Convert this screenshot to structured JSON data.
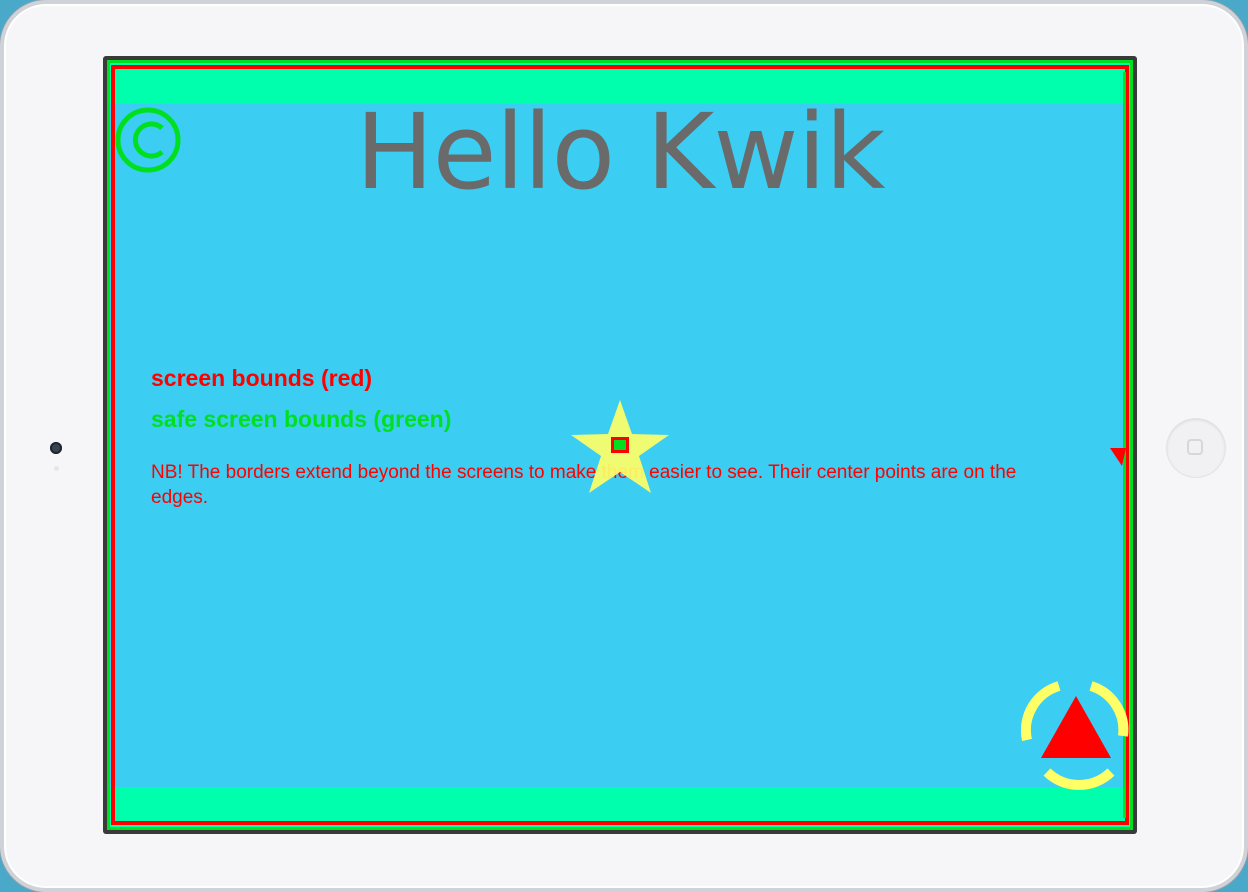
{
  "app": {
    "title": "Hello Kwik",
    "labels": {
      "screen_bounds": "screen bounds (red)",
      "safe_bounds": "safe screen bounds (green)"
    },
    "note": "NB! The borders extend beyond the screens to make them easier to see. Their center points are on the edges."
  },
  "icons": {
    "copyright": "copyright-icon",
    "star": "star-icon",
    "nav": "play-triangle-icon",
    "home": "home-button-icon"
  },
  "colors": {
    "background": "#3ccdf2",
    "safe_band": "#00ffac",
    "screen_bounds": "#ff0000",
    "safe_bounds": "#00e020",
    "title": "#6a6a6a",
    "star": "#ffff66"
  }
}
